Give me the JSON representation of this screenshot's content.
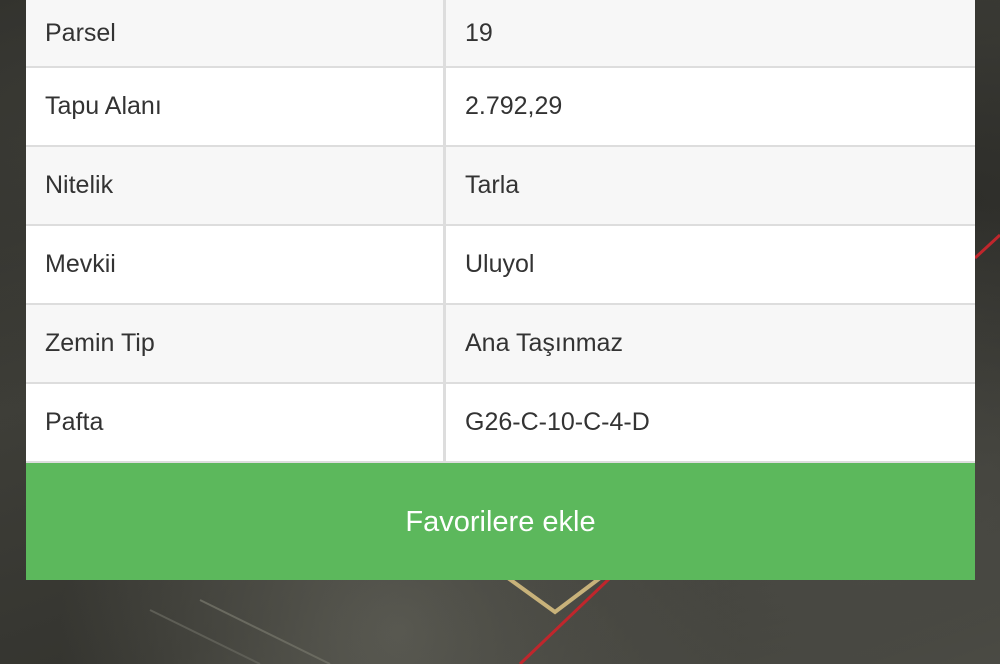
{
  "parcel_info": {
    "rows": [
      {
        "label": "Parsel",
        "value": "19"
      },
      {
        "label": "Tapu Alanı",
        "value": "2.792,29"
      },
      {
        "label": "Nitelik",
        "value": "Tarla"
      },
      {
        "label": "Mevkii",
        "value": "Uluyol"
      },
      {
        "label": "Zemin Tip",
        "value": "Ana Taşınmaz"
      },
      {
        "label": "Pafta",
        "value": "G26-C-10-C-4-D"
      }
    ]
  },
  "actions": {
    "favorite_label": "Favorilere ekle"
  },
  "colors": {
    "button_green": "#5cb85c",
    "parcel_boundary_red": "#c0262c",
    "parcel_outline_tan": "#c8b27a"
  }
}
